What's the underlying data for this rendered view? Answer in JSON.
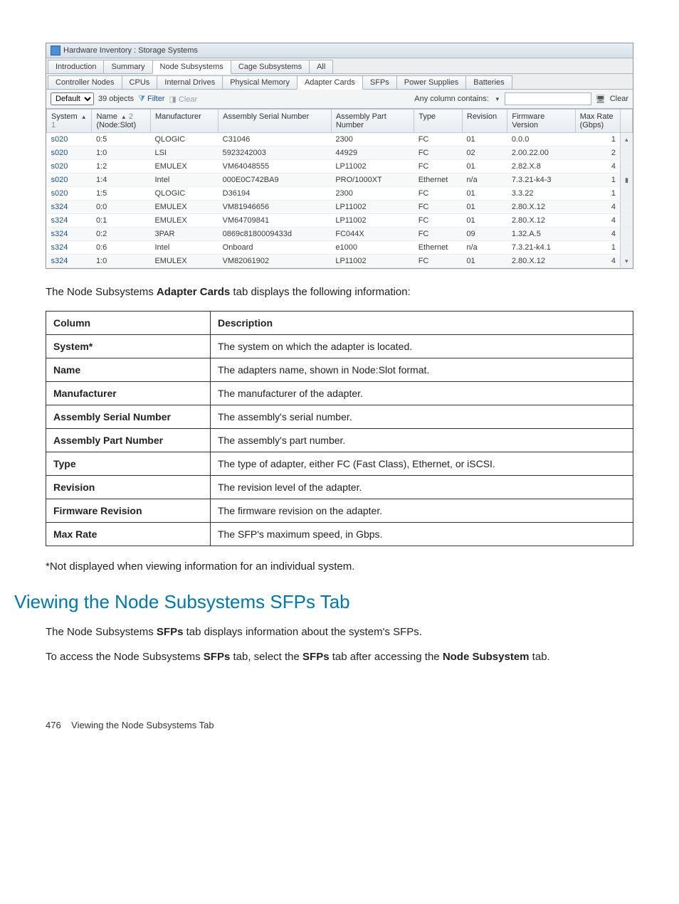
{
  "screenshot": {
    "title": "Hardware Inventory : Storage Systems",
    "main_tabs": [
      "Introduction",
      "Summary",
      "Node Subsystems",
      "Cage Subsystems",
      "All"
    ],
    "active_main_tab": 2,
    "sub_tabs": [
      "Controller Nodes",
      "CPUs",
      "Internal Drives",
      "Physical Memory",
      "Adapter Cards",
      "SFPs",
      "Power Supplies",
      "Batteries"
    ],
    "active_sub_tab": 4,
    "toolbar": {
      "select_value": "Default",
      "count_label": "39 objects",
      "filter_label": "Filter",
      "clear_label": "Clear",
      "any_col_label": "Any column contains:",
      "clear_right_label": "Clear"
    },
    "columns": [
      {
        "label": "System",
        "sort": "▲",
        "sort_note": "1"
      },
      {
        "label": "Name\n(Node:Slot)",
        "sort": "▲",
        "sort_note": "2"
      },
      {
        "label": "Manufacturer"
      },
      {
        "label": "Assembly Serial Number"
      },
      {
        "label": "Assembly Part Number"
      },
      {
        "label": "Type"
      },
      {
        "label": "Revision"
      },
      {
        "label": "Firmware Version"
      },
      {
        "label": "Max Rate (Gbps)"
      }
    ],
    "rows": [
      {
        "system": "s020",
        "name": "0:5",
        "manufacturer": "QLOGIC",
        "asn": "C31046",
        "apn": "2300",
        "type": "FC",
        "rev": "01",
        "fw": "0.0.0",
        "rate": "1"
      },
      {
        "system": "s020",
        "name": "1:0",
        "manufacturer": "LSI",
        "asn": "5923242003",
        "apn": "44929",
        "type": "FC",
        "rev": "02",
        "fw": "2.00.22.00",
        "rate": "2"
      },
      {
        "system": "s020",
        "name": "1:2",
        "manufacturer": "EMULEX",
        "asn": "VM64048555",
        "apn": "LP11002",
        "type": "FC",
        "rev": "01",
        "fw": "2.82.X.8",
        "rate": "4"
      },
      {
        "system": "s020",
        "name": "1:4",
        "manufacturer": "Intel",
        "asn": "000E0C742BA9",
        "apn": "PRO/1000XT",
        "type": "Ethernet",
        "rev": "n/a",
        "fw": "7.3.21-k4-3",
        "rate": "1"
      },
      {
        "system": "s020",
        "name": "1:5",
        "manufacturer": "QLOGIC",
        "asn": "D36194",
        "apn": "2300",
        "type": "FC",
        "rev": "01",
        "fw": "3.3.22",
        "rate": "1"
      },
      {
        "system": "s324",
        "name": "0:0",
        "manufacturer": "EMULEX",
        "asn": "VM81946656",
        "apn": "LP11002",
        "type": "FC",
        "rev": "01",
        "fw": "2.80.X.12",
        "rate": "4"
      },
      {
        "system": "s324",
        "name": "0:1",
        "manufacturer": "EMULEX",
        "asn": "VM64709841",
        "apn": "LP11002",
        "type": "FC",
        "rev": "01",
        "fw": "2.80.X.12",
        "rate": "4"
      },
      {
        "system": "s324",
        "name": "0:2",
        "manufacturer": "3PAR",
        "asn": "0869c8180009433d",
        "apn": "FC044X",
        "type": "FC",
        "rev": "09",
        "fw": "1.32.A.5",
        "rate": "4"
      },
      {
        "system": "s324",
        "name": "0:6",
        "manufacturer": "Intel",
        "asn": "Onboard",
        "apn": "e1000",
        "type": "Ethernet",
        "rev": "n/a",
        "fw": "7.3.21-k4.1",
        "rate": "1"
      },
      {
        "system": "s324",
        "name": "1:0",
        "manufacturer": "EMULEX",
        "asn": "VM82061902",
        "apn": "LP11002",
        "type": "FC",
        "rev": "01",
        "fw": "2.80.X.12",
        "rate": "4"
      }
    ]
  },
  "intro_prefix": "The Node Subsystems ",
  "intro_bold": "Adapter Cards",
  "intro_suffix": " tab displays the following information:",
  "def_header_col": "Column",
  "def_header_desc": "Description",
  "definitions": [
    {
      "col": "System*",
      "desc": "The system on which the adapter is located."
    },
    {
      "col": "Name",
      "desc": "The adapters name, shown in Node:Slot format."
    },
    {
      "col": "Manufacturer",
      "desc": "The manufacturer of the adapter."
    },
    {
      "col": "Assembly Serial Number",
      "desc": "The assembly's serial number."
    },
    {
      "col": "Assembly Part Number",
      "desc": "The assembly's part number."
    },
    {
      "col": "Type",
      "desc": "The type of adapter, either FC (Fast Class), Ethernet, or iSCSI."
    },
    {
      "col": "Revision",
      "desc": "The revision level of the adapter."
    },
    {
      "col": "Firmware Revision",
      "desc": "The firmware revision on the adapter."
    },
    {
      "col": "Max Rate",
      "desc": "The SFP's maximum speed, in Gbps."
    }
  ],
  "note": "*Not displayed when viewing information for an individual system.",
  "section_heading": "Viewing the Node Subsystems SFPs Tab",
  "p1_parts": [
    "The Node Subsystems ",
    "SFPs",
    " tab displays information about the system's SFPs."
  ],
  "p2_parts": [
    "To access the Node Subsystems ",
    "SFPs",
    " tab, select the ",
    "SFPs",
    " tab after accessing the ",
    "Node Subsystem",
    " tab."
  ],
  "footer_page": "476",
  "footer_text": "Viewing the Node Subsystems Tab"
}
